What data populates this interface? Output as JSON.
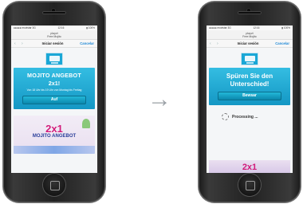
{
  "left_phone": {
    "status_left": "●●●●● movistar 3G",
    "status_time": "12:16",
    "status_right": "▮ 100%",
    "url_line1": "playvt",
    "url_line2": "Free Mojito",
    "nav_back": "‹ ›",
    "nav_title": "Iniciar sesión",
    "nav_cancel": "Cancelar",
    "promo_title": "MOJITO ANGEBOT",
    "promo_sub": "2x1!",
    "promo_small": "Von 18 Uhr bis 19 Uhr von Montag bis Freitag",
    "cta_label": "Auf",
    "banner_big": "2x1",
    "banner_text": "MOJITO ANGEBOT"
  },
  "right_phone": {
    "status_left": "●●●●● movistar 3G",
    "status_time": "12:16",
    "status_right": "▮ 100%",
    "url_line1": "playvt",
    "url_line2": "Free Mojito",
    "nav_back": "‹ ›",
    "nav_title": "Iniciar sesión",
    "nav_cancel": "Cancelar",
    "promo_title": "Spüren Sie den Unterschied!",
    "cta_label": "Bewsar",
    "processing_label": "Processing ...",
    "peek_big": "2x1"
  },
  "arrow": "→",
  "colors": {
    "accent_blue": "#1aa7d6",
    "cta": "#0b88ad",
    "magenta": "#d11a7a",
    "link_blue": "#1e88d6"
  }
}
